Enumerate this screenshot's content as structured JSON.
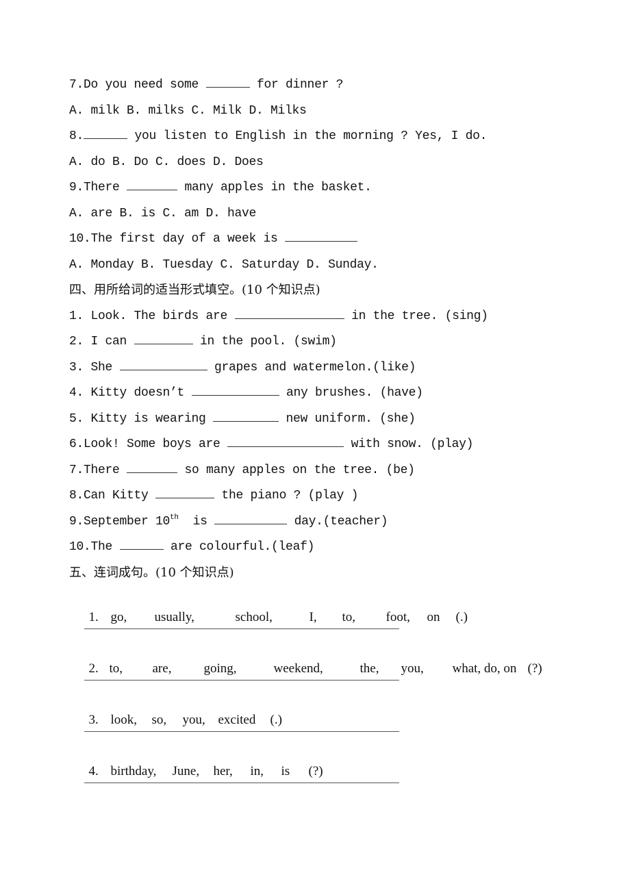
{
  "section3_continued": {
    "questions": [
      {
        "number": "7.",
        "before": "Do you need some ",
        "blank_chars": 6,
        "after": " for dinner ?",
        "options": "A. milk B. milks C. Milk D. Milks"
      },
      {
        "number": "8.",
        "before": "",
        "blank_chars": 6,
        "after": " you listen to English in the morning ? Yes, I do.",
        "options": "A. do B. Do C. does D. Does"
      },
      {
        "number": "9.",
        "before": "There ",
        "blank_chars": 7,
        "after": " many apples in the basket.",
        "options": "A. are B. is C. am D. have"
      },
      {
        "number": "10.",
        "before": "The first day of a week is ",
        "blank_chars": 10,
        "after": "",
        "options": "A. Monday B. Tuesday C. Saturday D. Sunday."
      }
    ]
  },
  "section4": {
    "heading": "四、用所给词的适当形式填空。(10 个知识点)",
    "items": [
      {
        "number": "1. ",
        "before": "Look. The birds are ",
        "blank_chars": 15,
        "after": " in the tree. (sing)"
      },
      {
        "number": "2. ",
        "before": "I can ",
        "blank_chars": 8,
        "after": " in the pool. (swim)"
      },
      {
        "number": "3. ",
        "before": "She ",
        "blank_chars": 12,
        "after": " grapes and watermelon.(like)"
      },
      {
        "number": "4. ",
        "before": "Kitty doesn’t ",
        "blank_chars": 12,
        "after": " any brushes. (have)"
      },
      {
        "number": "5. ",
        "before": "Kitty is wearing ",
        "blank_chars": 9,
        "after": " new uniform. (she)"
      },
      {
        "number": "6.",
        "before": "Look! Some boys are ",
        "blank_chars": 16,
        "after": " with snow. (play)"
      },
      {
        "number": "7.",
        "before": "There ",
        "blank_chars": 7,
        "after": " so many apples on the tree. (be)"
      },
      {
        "number": "8.",
        "before": "Can Kitty ",
        "blank_chars": 8,
        "after": " the piano ? (play )"
      },
      {
        "number": "9.",
        "before": "September 10",
        "sup": "th",
        "before2": "  is ",
        "blank_chars": 10,
        "after": " day.(teacher)"
      },
      {
        "number": "10.",
        "before": "The ",
        "blank_chars": 6,
        "after": " are colourful.(leaf)"
      }
    ]
  },
  "section5": {
    "heading": "五、连词成句。(10 个知识点)",
    "items": [
      {
        "number": "1.",
        "words": [
          "go,",
          "usually,",
          "school,",
          "I,",
          "to,",
          "foot,",
          "on",
          "(.)"
        ]
      },
      {
        "number": "2.",
        "words": [
          "to,",
          "are,",
          "going,",
          "weekend,",
          "the,",
          "you,",
          "what, do, on",
          "(?)"
        ]
      },
      {
        "number": "3.",
        "words": [
          "look,",
          "so,",
          "you,",
          "excited",
          "(.)"
        ]
      },
      {
        "number": "4.",
        "words": [
          "birthday,",
          "June,",
          "her,",
          "in,",
          "is",
          "(?)"
        ]
      }
    ]
  }
}
